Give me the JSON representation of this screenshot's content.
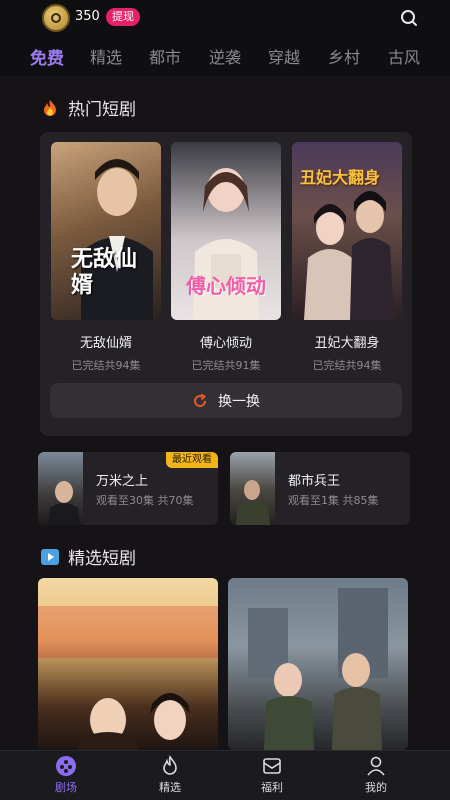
{
  "header": {
    "coin_count": "350",
    "withdraw_label": "提现"
  },
  "tabs": [
    {
      "label": "免费",
      "active": true
    },
    {
      "label": "精选"
    },
    {
      "label": "都市"
    },
    {
      "label": "逆袭"
    },
    {
      "label": "穿越"
    },
    {
      "label": "乡村"
    },
    {
      "label": "古风"
    }
  ],
  "hot": {
    "title": "热门短剧",
    "cards": [
      {
        "title": "无敌仙婿",
        "sub": "已完结共94集",
        "poster_text": "无敌仙婿"
      },
      {
        "title": "傅心倾动",
        "sub": "已完结共91集",
        "poster_text": "傅心倾动"
      },
      {
        "title": "丑妃大翻身",
        "sub": "已完结共94集",
        "poster_text": "丑妃大翻身"
      }
    ],
    "refresh_label": "换一换"
  },
  "recent": [
    {
      "title": "万米之上",
      "sub": "观看至30集 共70集",
      "badge": "最近观看"
    },
    {
      "title": "都市兵王",
      "sub": "观看至1集 共85集"
    }
  ],
  "featured": {
    "title": "精选短剧"
  },
  "bottom_nav": [
    {
      "label": "剧场",
      "active": true
    },
    {
      "label": "精选"
    },
    {
      "label": "福利"
    },
    {
      "label": "我的"
    }
  ],
  "colors": {
    "accent": "#9c7cf0",
    "withdraw": "#e5216a",
    "badge": "#f1b41a",
    "refresh_icon": "#e8582a"
  }
}
